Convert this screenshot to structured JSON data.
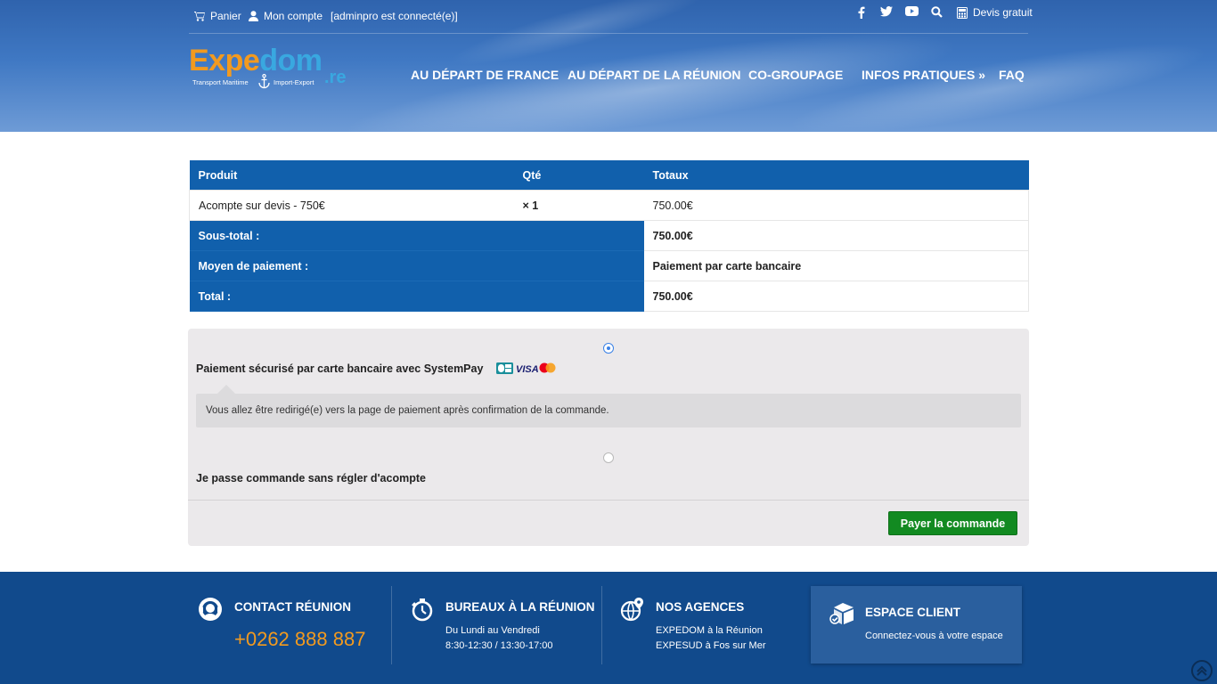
{
  "topbar": {
    "cart": "Panier",
    "account": "Mon compte",
    "connected": "[adminpro est connecté(e)]",
    "quote": "Devis gratuit",
    "social_icons": [
      "facebook-icon",
      "twitter-icon",
      "youtube-icon",
      "search-icon"
    ]
  },
  "logo": {
    "part1": "Expe",
    "part2": "dom",
    "suffix": ".re",
    "tagline_left": "Transport Maritime",
    "tagline_right": "Import-Export"
  },
  "nav": {
    "items": [
      "AU DÉPART DE FRANCE",
      "AU DÉPART DE LA RÉUNION",
      "CO-GROUPAGE",
      "INFOS PRATIQUES »",
      "FAQ"
    ]
  },
  "order": {
    "headers": [
      "Produit",
      "Qté",
      "Totaux"
    ],
    "item": {
      "name": "Acompte sur devis - 750€",
      "qty": "× 1",
      "total": "750.00€"
    },
    "subtotal_label": "Sous-total :",
    "subtotal_value": "750.00€",
    "payment_label": "Moyen de paiement :",
    "payment_value": "Paiement par carte bancaire",
    "total_label": "Total :",
    "total_value": "750.00€"
  },
  "payment": {
    "option1_label": "Paiement sécurisé par carte bancaire avec SystemPay",
    "option1_selected": true,
    "option1_notice": "Vous allez être redirigé(e) vers la page de paiement après confirmation de la commande.",
    "option2_label": "Je passe commande sans régler d'acompte",
    "option2_selected": false,
    "card_logos": {
      "visa": "VISA"
    },
    "submit_label": "Payer la commande"
  },
  "footer": {
    "contact_title": "CONTACT RÉUNION",
    "contact_phone": "+0262 888 887",
    "offices_title": "BUREAUX À LA RÉUNION",
    "offices_line1": "Du Lundi au Vendredi",
    "offices_line2": "8:30-12:30 / 13:30-17:00",
    "agencies_title": "NOS AGENCES",
    "agencies_line1": "EXPEDOM à la Réunion",
    "agencies_line2": "EXPESUD à Fos sur Mer",
    "client_title": "ESPACE CLIENT",
    "client_text": "Connectez-vous à votre espace"
  },
  "colors": {
    "primary_blue": "#1160ac",
    "footer_blue": "#114a8c",
    "accent_orange": "#f29a1f",
    "pay_green": "#128a21"
  }
}
